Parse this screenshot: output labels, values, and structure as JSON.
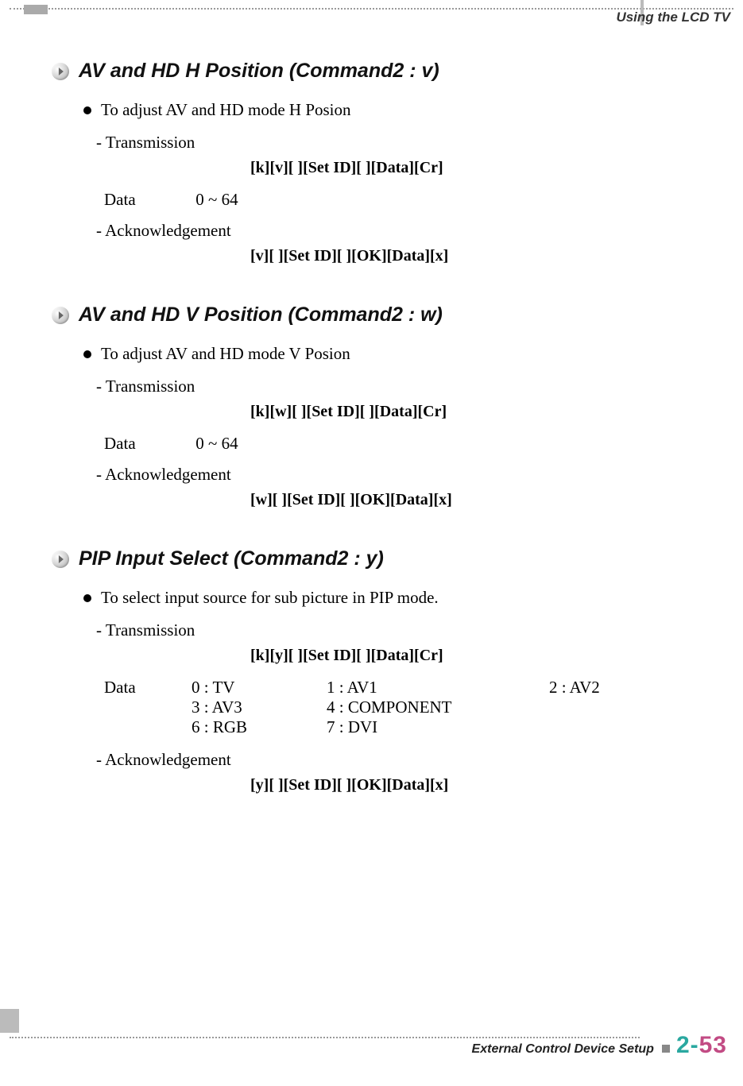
{
  "header": {
    "section": "Using the LCD TV"
  },
  "sections": [
    {
      "title": "AV and HD H Position (Command2 : v)",
      "desc": "To adjust AV and HD mode H Posion",
      "trans_label": "- Transmission",
      "trans_code": "[k][v][ ][Set ID][ ][Data][Cr]",
      "data_label": "Data",
      "data_value": "0 ~ 64",
      "ack_label": "- Acknowledgement",
      "ack_code": "[v][ ][Set ID][ ][OK][Data][x]"
    },
    {
      "title": "AV and HD V Position (Command2 : w)",
      "desc": "To adjust AV and HD mode V Posion",
      "trans_label": "- Transmission",
      "trans_code": "[k][w][ ][Set ID][ ][Data][Cr]",
      "data_label": "Data",
      "data_value": "0 ~ 64",
      "ack_label": "- Acknowledgement",
      "ack_code": "[w][ ][Set ID][ ][OK][Data][x]"
    },
    {
      "title": "PIP Input Select (Command2 : y)",
      "desc": "To select input source for sub picture in PIP mode.",
      "trans_label": "- Transmission",
      "trans_code": "[k][y][ ][Set ID][ ][Data][Cr]",
      "data_label": "Data",
      "grid": [
        [
          "0 : TV",
          "1 : AV1",
          "2 : AV2"
        ],
        [
          "3 : AV3",
          "4 : COMPONENT",
          ""
        ],
        [
          "6 : RGB",
          "7 : DVI",
          ""
        ]
      ],
      "ack_label": "- Acknowledgement",
      "ack_code": "[y][ ][Set ID][ ][OK][Data][x]"
    }
  ],
  "footer": {
    "label": "External Control Device Setup",
    "page_prefix": "2-",
    "page_number": "53"
  }
}
